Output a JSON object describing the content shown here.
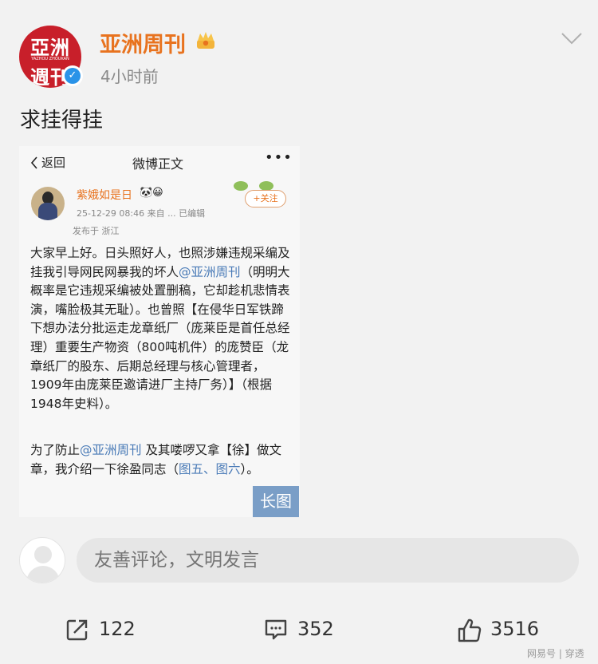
{
  "account": {
    "name": "亚洲周刊",
    "avatar_logo_top": "亞洲",
    "avatar_logo_mid": "YAZHOU ZHOUKAN",
    "avatar_logo_bottom": "週刊",
    "time": "4小时前"
  },
  "post": {
    "text": "求挂得挂"
  },
  "screenshot": {
    "back_label": "返回",
    "title": "微博正文",
    "more": "•••",
    "user_name": "紫娥如是日",
    "user_badges": "🐼😀",
    "meta": "25-12-29 08:46  来自 ...  已编辑",
    "location": "发布于 浙江",
    "follow_label": "+关注",
    "para1_a": "大家早上好。日头照好人，也照涉嫌违规采编及挂我引导网民网暴我的坏人",
    "para1_mention": "@亚洲周刊",
    "para1_b": "（明明大概率是它违规采编被处置删稿，它却趁机悲情表演，嘴脸极其无耻）。也曾照【在侵华日军铁蹄下想办法分批运走龙章纸厂（庞莱臣是首任总经理）重要生产物资（800吨机件）的庞赞臣（龙章纸厂的股东、后期总经理与核心管理者，1909年由庞莱臣邀请进厂主持厂务）】（根据1948年史料）。",
    "para2_a": "为了防止",
    "para2_mention": "@亚洲周刊",
    "para2_b": " 及其喽啰又拿【徐】做文章，我介绍一下徐盈同志（",
    "para2_link": "图五、图六",
    "para2_c": "）。",
    "long_image_tag": "长图"
  },
  "comment": {
    "placeholder": "友善评论，文明发言"
  },
  "actions": {
    "share_count": "122",
    "comment_count": "352",
    "like_count": "3516"
  },
  "watermark": "网易号 | 穿透",
  "colors": {
    "accent_orange": "#e8731f",
    "link_blue": "#4a7bb7",
    "brand_red": "#c81f2a",
    "verified_blue": "#2a93e8"
  }
}
